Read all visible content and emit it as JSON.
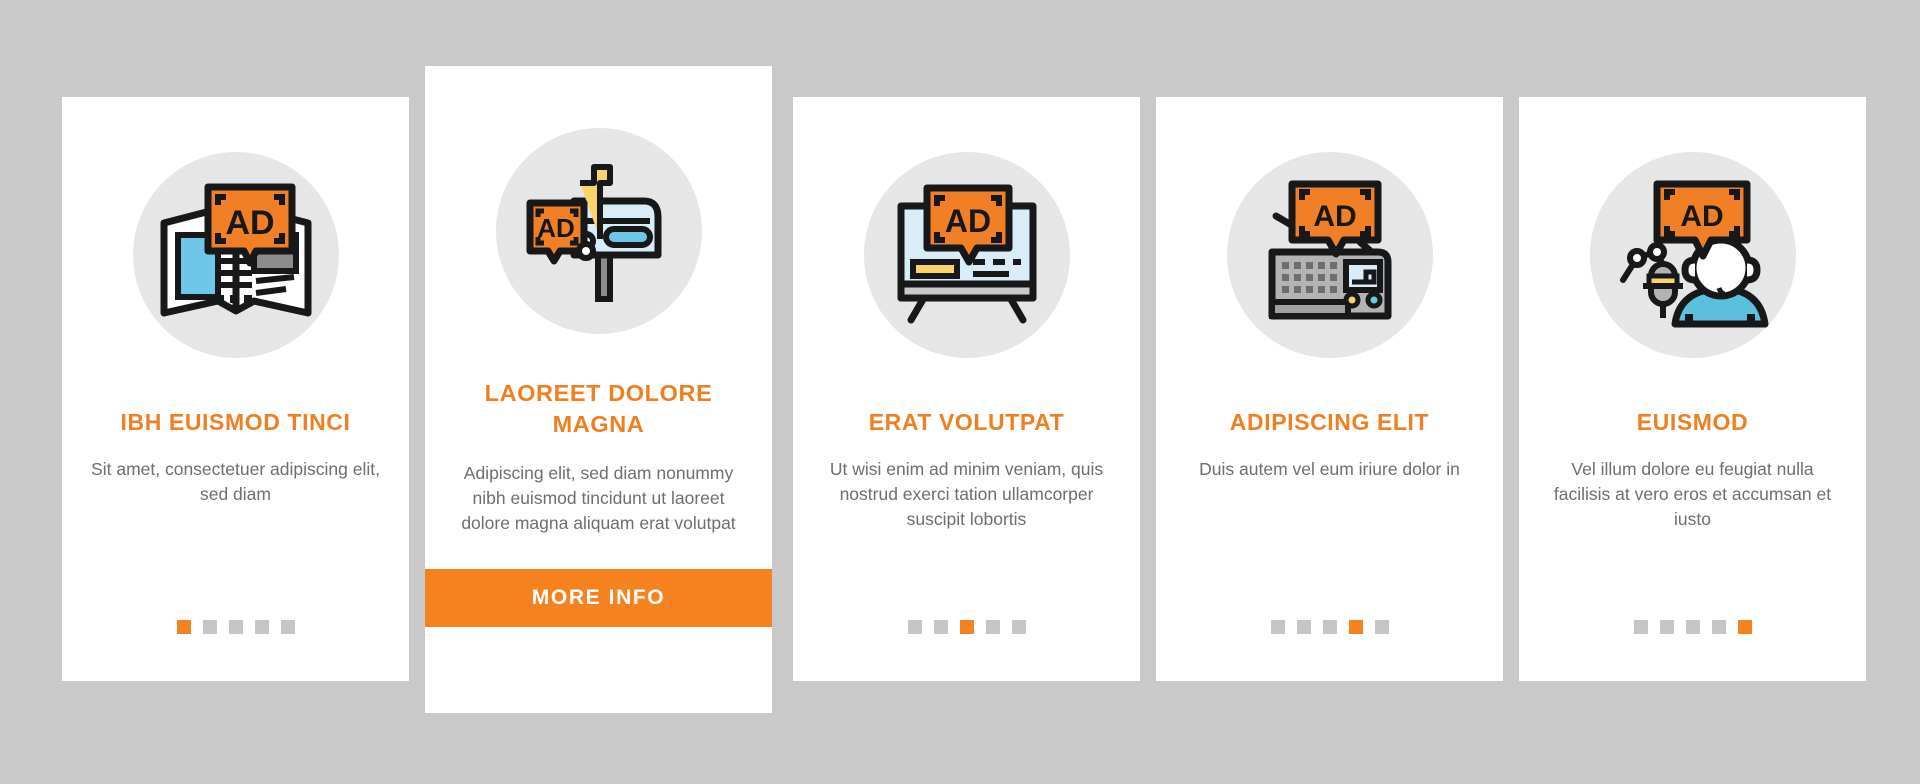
{
  "page": {
    "background_color": "#c9c9c9",
    "accent_color": "#f5821f",
    "title_color": "#ef8022",
    "body_color": "#6d6e71",
    "dot_color": "#c6c6c6"
  },
  "cards": [
    {
      "icon_name": "newspaper-ad-icon",
      "title": "IBH EUISMOD TINCI",
      "body": "Sit amet, consectetuer adipiscing elit, sed diam",
      "dots": [
        true,
        false,
        false,
        false,
        false
      ],
      "featured": false
    },
    {
      "icon_name": "mailbox-ad-icon",
      "title": "LAOREET DOLORE MAGNA",
      "body": "Adipiscing elit, sed diam nonummy nibh euismod tincidunt ut laoreet dolore magna aliquam erat volutpat",
      "dots": [
        false,
        false,
        false,
        false,
        false
      ],
      "featured": true,
      "button_label": "MORE INFO"
    },
    {
      "icon_name": "television-ad-icon",
      "title": "ERAT VOLUTPAT",
      "body": "Ut wisi enim ad minim veniam, quis nostrud exerci tation ullamcorper suscipit lobortis",
      "dots": [
        false,
        false,
        true,
        false,
        false
      ],
      "featured": false
    },
    {
      "icon_name": "radio-ad-icon",
      "title": "ADIPISCING ELIT",
      "body": "Duis autem vel eum iriure dolor in",
      "dots": [
        false,
        false,
        false,
        true,
        false
      ],
      "featured": false
    },
    {
      "icon_name": "podcast-announcer-ad-icon",
      "title": "EUISMOD",
      "body": "Vel illum dolore eu feugiat nulla facilisis at vero eros et accumsan et iusto",
      "dots": [
        false,
        false,
        false,
        false,
        true
      ],
      "featured": false
    }
  ]
}
